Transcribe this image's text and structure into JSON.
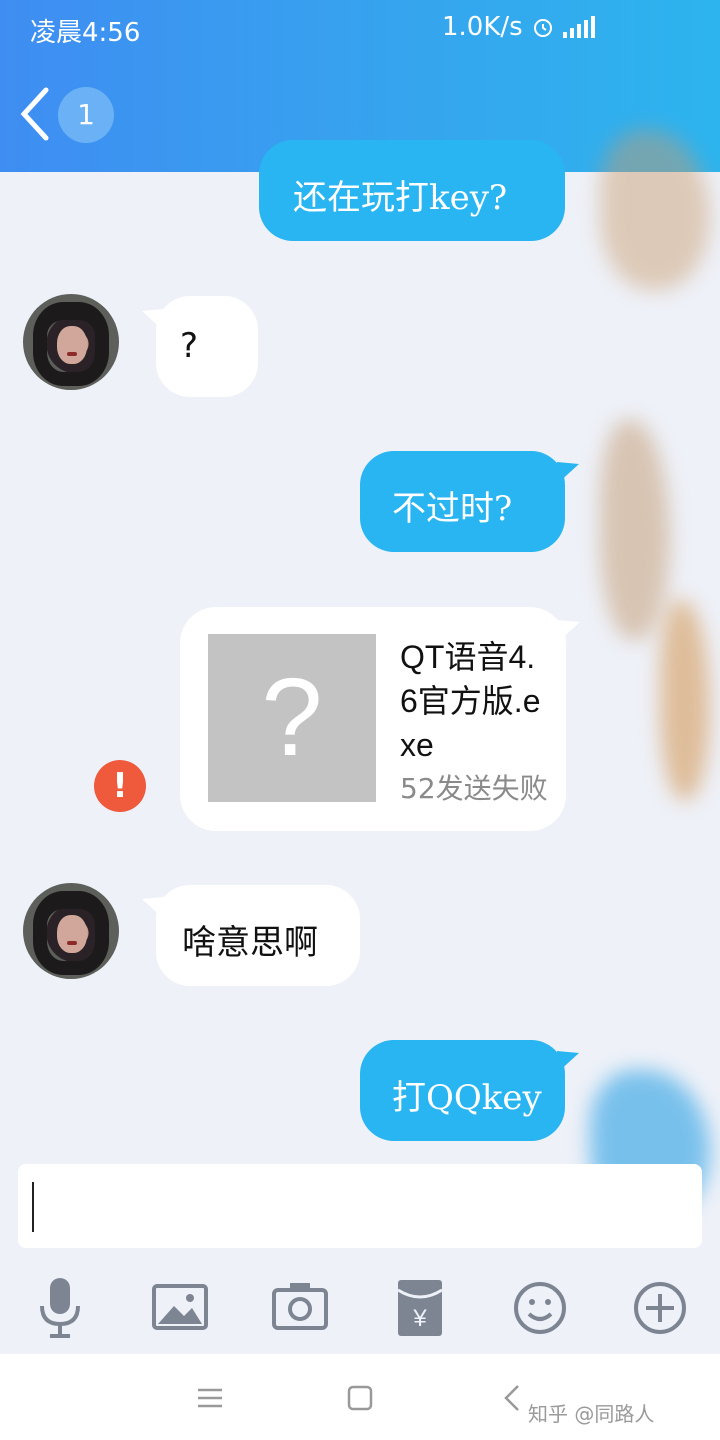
{
  "status_bar": {
    "time": "凌晨4:56",
    "network_speed": "1.0K/s",
    "alarm_icon": "alarm-icon",
    "signal_icon": "signal-icon"
  },
  "header": {
    "back_icon": "chevron-left-icon",
    "unread_count": "1"
  },
  "messages": [
    {
      "direction": "out",
      "text": "还在玩打key?"
    },
    {
      "direction": "in",
      "text": "?"
    },
    {
      "direction": "out",
      "text": "不过时?"
    },
    {
      "direction": "out",
      "type": "file",
      "file_name": "QT语音4.6官方版.exe",
      "meta": "52发送失败",
      "status": "failed"
    },
    {
      "direction": "in",
      "text": "啥意思啊"
    },
    {
      "direction": "out",
      "text": "打QQkey"
    }
  ],
  "input": {
    "value": ""
  },
  "toolbar": {
    "icons": [
      "microphone-icon",
      "image-icon",
      "camera-icon",
      "red-envelope-icon",
      "emoji-icon",
      "plus-icon"
    ],
    "red_envelope_symbol": "¥"
  },
  "navbar": {
    "icons": [
      "menu-icon",
      "home-icon",
      "back-icon"
    ],
    "watermark": "知乎 @同路人"
  },
  "colors": {
    "header_blue": "#3f8df2",
    "outgoing_bubble": "#28b5f2",
    "incoming_bubble": "#ffffff",
    "error_red": "#ef5a3c"
  }
}
